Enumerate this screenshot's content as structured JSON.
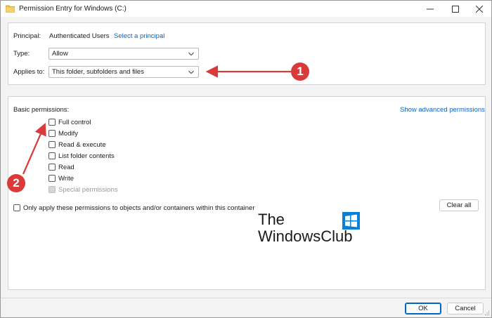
{
  "window": {
    "title": "Permission Entry for Windows (C:)",
    "controls": {
      "minimize": "—",
      "maximize": "☐",
      "close": "✕"
    }
  },
  "principal": {
    "label": "Principal:",
    "value": "Authenticated Users",
    "select_link": "Select a principal"
  },
  "type": {
    "label": "Type:",
    "value": "Allow"
  },
  "applies_to": {
    "label": "Applies to:",
    "value": "This folder, subfolders and files"
  },
  "basic_permissions": {
    "label": "Basic permissions:",
    "advanced_link": "Show advanced permissions",
    "items": [
      {
        "label": "Full control",
        "checked": false,
        "disabled": false
      },
      {
        "label": "Modify",
        "checked": false,
        "disabled": false
      },
      {
        "label": "Read & execute",
        "checked": false,
        "disabled": false
      },
      {
        "label": "List folder contents",
        "checked": false,
        "disabled": false
      },
      {
        "label": "Read",
        "checked": false,
        "disabled": false
      },
      {
        "label": "Write",
        "checked": false,
        "disabled": false
      },
      {
        "label": "Special permissions",
        "checked": false,
        "disabled": true
      }
    ]
  },
  "only_apply": {
    "label": "Only apply these permissions to objects and/or containers within this container",
    "checked": false
  },
  "clear_all": "Clear all",
  "buttons": {
    "ok": "OK",
    "cancel": "Cancel"
  },
  "annotations": {
    "callout_1": "1",
    "callout_2": "2",
    "color": "#d93a3a"
  },
  "watermark": {
    "line1": "The",
    "line2": "WindowsClub"
  },
  "colors": {
    "link": "#0b63c4",
    "primary_border": "#0067c0",
    "accent": "#d93a3a"
  },
  "icons": {
    "app": "folder-icon",
    "chevron": "chevron-down-icon",
    "logo": "windows-logo-icon"
  }
}
